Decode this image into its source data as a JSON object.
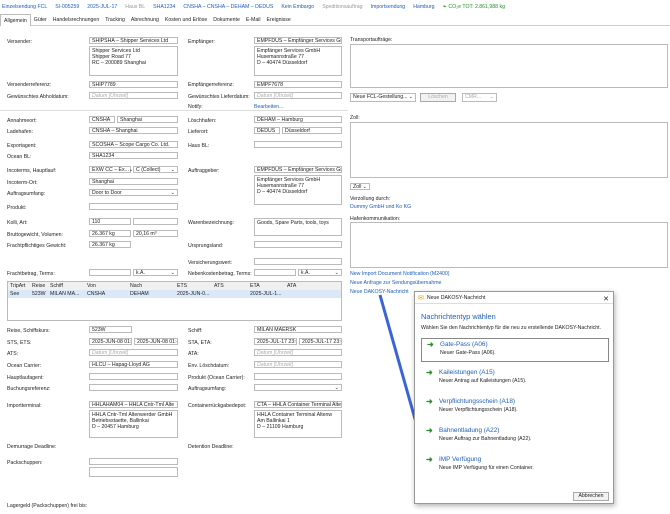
{
  "header": {
    "title": "Einzelsendung FCL",
    "ref": "SI-005259",
    "date": "2025-JUL-17",
    "haus_bl": "Haus BL",
    "sha": "SHA1234",
    "route": "CNSHA – CNSHA – DEHAM – DEDUS",
    "embargo": "Kein Embargo",
    "speditionsauftrag": "Speditionsauftrag",
    "direction": "Importsendung",
    "branch": "Hamburg",
    "co2": "CO₂e TOT: 2.861,988 kg"
  },
  "tabs": [
    "Allgemein",
    "Güter",
    "Handelsrechnungen",
    "Tracking",
    "Abrechnung",
    "Kosten und Erlöse",
    "Dokumente",
    "E-Mail",
    "Ereignisse"
  ],
  "left": {
    "versender_label": "Versender:",
    "versender_sel": "SHIPSHA – Shipper Services Ltd",
    "versender_addr": "Shipper Services Ltd\nShipper Road 77\nRC – 200089 Shanghai",
    "versenderreferenz_label": "Versenderreferenz:",
    "versenderreferenz": "SHIP7789",
    "abholdatum_label": "Gewünschtes Abholdatum:",
    "date_placeholder": "Datum [Uhrzeit]",
    "annahmeort_label": "Annahmeort:",
    "annahmeort_code": "CNSHA",
    "annahmeort_name": "Shanghai",
    "ladehafen_label": "Ladehafen:",
    "ladehafen": "CNSHA – Shanghai",
    "exportagent_label": "Exportagent:",
    "exportagent": "SCOSHA – Scope Cargo Co. Ltd.",
    "ocean_bl_label": "Ocean BL:",
    "ocean_bl": "SHA1234",
    "incoterms_label": "Incoterms, Hauptlauf:",
    "incoterms": "EXW CC – Ex...",
    "incoterms_coll": "C (Collect)",
    "incoterms_ort_label": "Incoterm-Ort:",
    "incoterms_ort": "Shanghai",
    "auftragsumfang_label": "Auftragsumfang:",
    "auftragsumfang": "Door to Door",
    "produkt_label": "Produkt:",
    "kolli_label": "Kolli, Art:",
    "kolli": "110",
    "brutto_label": "Bruttogewicht, Volumen:",
    "brutto": "26.367 kg",
    "volumen": "20,16 m³",
    "fracht_label": "Frachtpflichtiges Gewicht:",
    "fracht": "26.367 kg",
    "frachtbetrag_label": "Frachtbetrag, Terms:",
    "terms": "k.A."
  },
  "middle": {
    "empfaenger_label": "Empfänger:",
    "empfaenger_sel": "EMPFDUS – Empfänger Services Gmb",
    "empfaenger_addr": "Empfänger Services GmbH\nHusemannstraße 77\nD – 40474 Düsseldorf",
    "empfref_label": "Empfängerreferenz:",
    "empfref": "EMPF7678",
    "lieferdatum_label": "Gewünschtes Lieferdatum:",
    "notify_label": "Notify:",
    "bearbeiten": "Bearbeiten...",
    "loeschhafen_label": "Löschhafen:",
    "loeschhafen": "DEHAM – Hamburg",
    "lieferort_label": "Lieferort:",
    "lieferort_code": "DEDUS",
    "lieferort_name": "Düsseldorf",
    "hausbl_label": "Haus BL:",
    "auftraggeber_label": "Auftraggeber:",
    "auftraggeber_sel": "EMPFDUS – Empfänger Services Gmb",
    "auftraggeber_addr": "Empfänger Services GmbH\nHusemannstraße 77\nD – 40474 Düsseldorf",
    "warenbez_label": "Warenbezeichnung:",
    "warenbez": "Goods, Spare Parts, tools, toys",
    "ursprung_label": "Ursprungsland:",
    "versicherung_label": "Versicherungswert:",
    "nebenkosten_label": "Nebenkostenbetrag, Terms:",
    "terms": "k.A."
  },
  "grid": {
    "headers": [
      "TripArt",
      "Reise",
      "Schiff",
      "Von",
      "Nach",
      "ETS",
      "ATS",
      "ETA",
      "ATA"
    ],
    "row": [
      "See",
      "523W",
      "MILAN MA...",
      "CNSHA",
      "DEHAM",
      "2025-JUN-0...",
      "",
      "2025-JUL-1...",
      ""
    ]
  },
  "bottom": {
    "reise_label": "Reise, Schiffskurs:",
    "reise": "523W",
    "ets_label": "STS, ETS:",
    "ets1": "2025-JUN-08 01:4",
    "ets2": "2025-JUN-08 01:4",
    "ats_label": "ATS:",
    "carrier_label": "Ocean Carrier:",
    "carrier": "HLCU – Hapag-Lloyd AG",
    "hauptlauf_label": "Hauptlaufagent:",
    "buchung_label": "Buchungsreferenz:",
    "importterminal_label": "Importterminal:",
    "importterminal_sel": "HHLAHAM04 – HHLA Cntr-Tml Alte",
    "importterminal_addr": "HHLA Cntr-Tml Altenwerder GmbH\nBetriebsstaette, Ballinkai\nD – 20457 Hamburg",
    "demurrage_label": "Demurrage Deadline:",
    "packschuppen_label": "Packschuppen:",
    "lagergeld_label": "Lagergeld (Packschuppen) frei bis:",
    "schiff_label": "Schiff:",
    "schiff": "MILAN MAERSK",
    "sta_label": "STA, ETA:",
    "sta1": "2025-JUL-17 23:0",
    "sta2": "2025-JUL-17 23:0",
    "ata_label": "ATA:",
    "loeschdatum_label": "Env. Löschdatum:",
    "produkt_label": "Produkt (Ocean Carrier):",
    "auftragsumfang_label": "Auftragsumfang:",
    "containerrueck_label": "Containerrückgabedepot:",
    "containerrueck_sel": "CTA – HHLA Container Terminal Alte",
    "containerrueck_addr": "HHLA Container Terminal Altenw\nAm Ballinkai 1\nD – 21109 Hamburg",
    "detention_label": "Detention Deadline:"
  },
  "right": {
    "transport_label": "Transportaufträge:",
    "neue_fcl": "Neue FCL-Gestellung...",
    "loeschen": "Löschen",
    "cmr": "CMR...",
    "zoll_label": "Zoll:",
    "zoll_sel": "Zoll",
    "verzollung_label": "Verzollung durch:",
    "verzollung": "Dummy GmbH und Ko KG",
    "hafenkomm_label": "Hafenkommunikation:",
    "links": [
      "New Import Document Notification (M2400)",
      "Neue Anfrage zur Sendungsübernahme",
      "Neue DAKOSY-Nachricht"
    ]
  },
  "dialog": {
    "title": "Neue DAKOSY-Nachricht",
    "heading": "Nachrichtentyp wählen",
    "desc": "Wählen Sie den Nachrichtentyp für die neu zu erstellende DAKOSY-Nachricht.",
    "options": [
      {
        "title": "Gate-Pass (A06)",
        "sub": "Neuer Gate-Pass (A06)."
      },
      {
        "title": "Kaileistungen (A15)",
        "sub": "Neuer Antrag auf Kaileistungen (A15)."
      },
      {
        "title": "Verpflichtungsschein (A18)",
        "sub": "Neuer Verpflichtungsschein (A18)."
      },
      {
        "title": "Bahnentladung (A22)",
        "sub": "Neuer Auftrag zur Bahnentladung (A22)."
      },
      {
        "title": "IMP Verfügung",
        "sub": "Neue IMP Verfügung für einen Container."
      }
    ],
    "cancel": "Abbrechen"
  },
  "colors": {
    "accent": "#1f5fb8",
    "arrow": "#3b64d6",
    "green": "#2e8b2e"
  }
}
